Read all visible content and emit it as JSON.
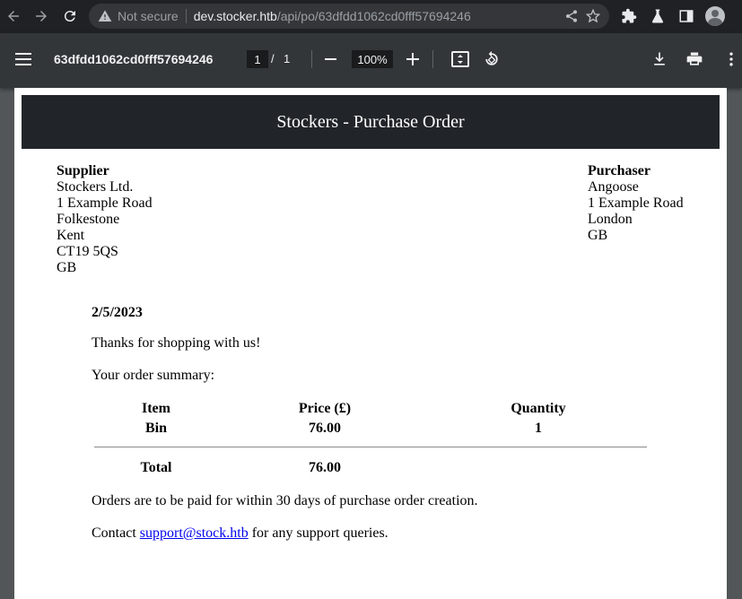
{
  "browser": {
    "not_secure": "Not secure",
    "url_host": "dev.stocker.htb",
    "url_path": "/api/po/63dfdd1062cd0fff57694246"
  },
  "pdf_viewer": {
    "title": "63dfdd1062cd0fff57694246",
    "page_current": "1",
    "page_sep": "/",
    "page_total": "1",
    "zoom": "100%"
  },
  "document": {
    "header": "Stockers - Purchase Order",
    "supplier": {
      "label": "Supplier",
      "lines": [
        "Stockers Ltd.",
        "1 Example Road",
        "Folkestone",
        "Kent",
        "CT19 5QS",
        "GB"
      ]
    },
    "purchaser": {
      "label": "Purchaser",
      "lines": [
        "Angoose",
        "1 Example Road",
        "London",
        "GB"
      ]
    },
    "date": "2/5/2023",
    "thanks": "Thanks for shopping with us!",
    "summary_label": "Your order summary:",
    "table": {
      "headers": [
        "Item",
        "Price (£)",
        "Quantity"
      ],
      "rows": [
        [
          "Bin",
          "76.00",
          "1"
        ]
      ],
      "total_label": "Total",
      "total_value": "76.00"
    },
    "terms": "Orders are to be paid for within 30 days of purchase order creation.",
    "contact_prefix": "Contact ",
    "contact_link": "support@stock.htb",
    "contact_suffix": " for any support queries."
  },
  "colors": {
    "chrome_bg": "#202124",
    "pdf_toolbar_bg": "#323639",
    "viewer_bg": "#525659",
    "doc_header_bg": "#212529",
    "link": "#0000ee"
  }
}
